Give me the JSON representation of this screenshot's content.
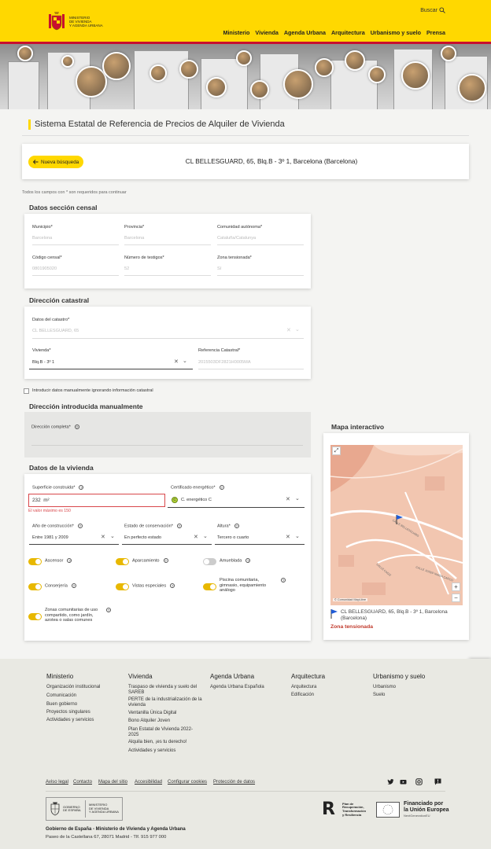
{
  "header": {
    "ministry_line1": "Ministerio",
    "ministry_line2": "de Vivienda",
    "ministry_line3": "y Agenda Urbana",
    "search_label": "Buscar",
    "nav": [
      "Ministerio",
      "Vivienda",
      "Agenda Urbana",
      "Arquitectura",
      "Urbanismo y suelo",
      "Prensa"
    ]
  },
  "page": {
    "title": "Sistema Estatal de Referencia de Precios de Alquiler de Vivienda",
    "new_search": "Nueva búsqueda",
    "address": "CL BELLESGUARD, 65, Blq.B - 3º 1, Barcelona (Barcelona)",
    "hint": "Todos los campos con * son requeridos para continuar"
  },
  "censal": {
    "title": "Datos sección censal",
    "municipio_label": "Municipio*",
    "municipio_value": "Barcelona",
    "provincia_label": "Provincia*",
    "provincia_value": "Barcelona",
    "comunidad_label": "Comunidad autónoma*",
    "comunidad_value": "Cataluña/Catalunya",
    "codigo_label": "Código censal*",
    "codigo_value": "0801905020",
    "testigos_label": "Número de testigos*",
    "testigos_value": "52",
    "zona_label": "Zona tensionada*",
    "zona_value": "Sí"
  },
  "catastral": {
    "title": "Dirección catastral",
    "datos_label": "Datos del catastro*",
    "datos_value": "CL BELLESGUARD, 65",
    "vivienda_label": "Vivienda*",
    "vivienda_value": "Blq.B - 3º 1",
    "ref_label": "Referencia Catastral*",
    "ref_value": "2015503DF2821H0005MA"
  },
  "manual": {
    "checkbox_label": "Introducir datos manualmente ignorando información catastral",
    "title": "Dirección introducida manualmente",
    "direccion_label": "Dirección completa*"
  },
  "vivienda": {
    "title": "Datos de la vivienda",
    "superficie_label": "Superficie construida*",
    "superficie_value": "232",
    "superficie_unit": "m²",
    "superficie_error": "El valor máximo es 150",
    "certificado_label": "Certificado energético*",
    "certificado_value": "C. energético C",
    "certificado_badge": "C",
    "anio_label": "Año de construcción*",
    "anio_value": "Entre 1981 y 2009",
    "estado_label": "Estado de conservación*",
    "estado_value": "En perfecto estado",
    "altura_label": "Altura*",
    "altura_value": "Tercero o cuarto",
    "toggles": [
      {
        "label": "Ascensor",
        "on": true
      },
      {
        "label": "Aparcamiento",
        "on": true
      },
      {
        "label": "Amueblada",
        "on": false
      },
      {
        "label": "Conserjería",
        "on": true
      },
      {
        "label": "Vistas especiales",
        "on": true
      },
      {
        "label": "Piscina comunitaria, gimnasio, equipamiento análogo",
        "on": true
      },
      {
        "label": "Zonas comunitarias de uso compartido, como jardín, azotea o salas comunes",
        "on": true
      }
    ]
  },
  "map": {
    "title": "Mapa interactivo",
    "address": "CL BELLESGUARD, 65, Blq.B - 3º 1, Barcelona (Barcelona)",
    "zona": "Zona tensionada",
    "street1": "CALLE BELLESGUARD",
    "street2": "CALLE JOSEP MARIA CARCO",
    "street3": "CALLE CADIZ",
    "attribution": "© Comunidad MapLibre",
    "zoom_in": "+",
    "zoom_out": "−"
  },
  "footer": {
    "cols": [
      {
        "title": "Ministerio",
        "links": [
          "Organización institucional",
          "Comunicación",
          "Buen gobierno",
          "Proyectos singulares",
          "Actividades y servicios"
        ]
      },
      {
        "title": "Vivienda",
        "links": [
          "Traspaso de vivienda y suelo del SAREB",
          "PERTE de la industrialización de la vivienda",
          "Ventanilla Única Digital",
          "Bono Alquiler Joven",
          "Plan Estatal de Vivienda 2022-2025",
          "Alquila bien, ¡es tu derecho!",
          "Actividades y servicios"
        ]
      },
      {
        "title": "Agenda Urbana",
        "links": [
          "Agenda Urbana Española"
        ]
      },
      {
        "title": "Arquitectura",
        "links": [
          "Arquitectura",
          "Edificación"
        ]
      },
      {
        "title": "Urbanismo y suelo",
        "links": [
          "Urbanismo",
          "Suelo"
        ]
      }
    ],
    "bottom_links": [
      "Aviso legal",
      "Contacto",
      "Mapa del sitio",
      "Accesibilidad",
      "Configurar cookies",
      "Protección de datos"
    ],
    "gov_logo_l1": "Gobierno",
    "gov_logo_l2": "de España",
    "gov_logo_r1": "Ministerio",
    "gov_logo_r2": "de Vivienda",
    "gov_logo_r3": "y Agenda Urbana",
    "plan_text1": "Plan de",
    "plan_text2": "Recuperación,",
    "plan_text3": "Transformación",
    "plan_text4": "y Resiliencia",
    "eu_text1": "Financiado por",
    "eu_text2": "la Unión Europea",
    "eu_text3": "NextGenerationEU",
    "gov_line": "Gobierno de España - Ministerio de Vivienda y Agenda Urbana",
    "address": "Paseo de la Castellana 67, 28071 Madrid - Tlf. 915 977 000"
  }
}
